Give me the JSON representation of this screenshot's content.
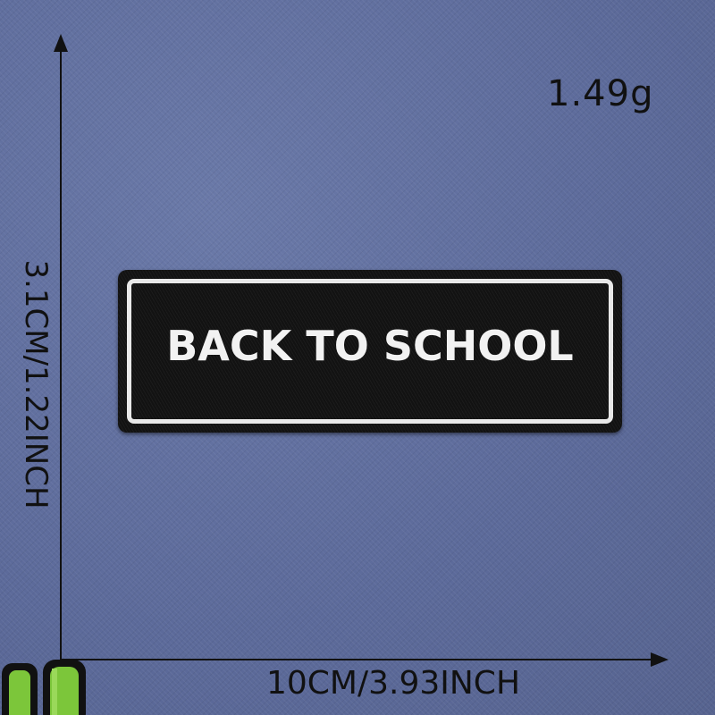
{
  "measurements": {
    "weight": "1.49g",
    "width_label": "10CM/3.93INCH",
    "height_label": "3.1CM/1.22INCH"
  },
  "patch": {
    "text": "BACK TO SCHOOL",
    "background_color": "#121212",
    "border_color": "#e8e8e8",
    "text_color": "#f2f2f2"
  },
  "background_color": "#5f6e9e"
}
